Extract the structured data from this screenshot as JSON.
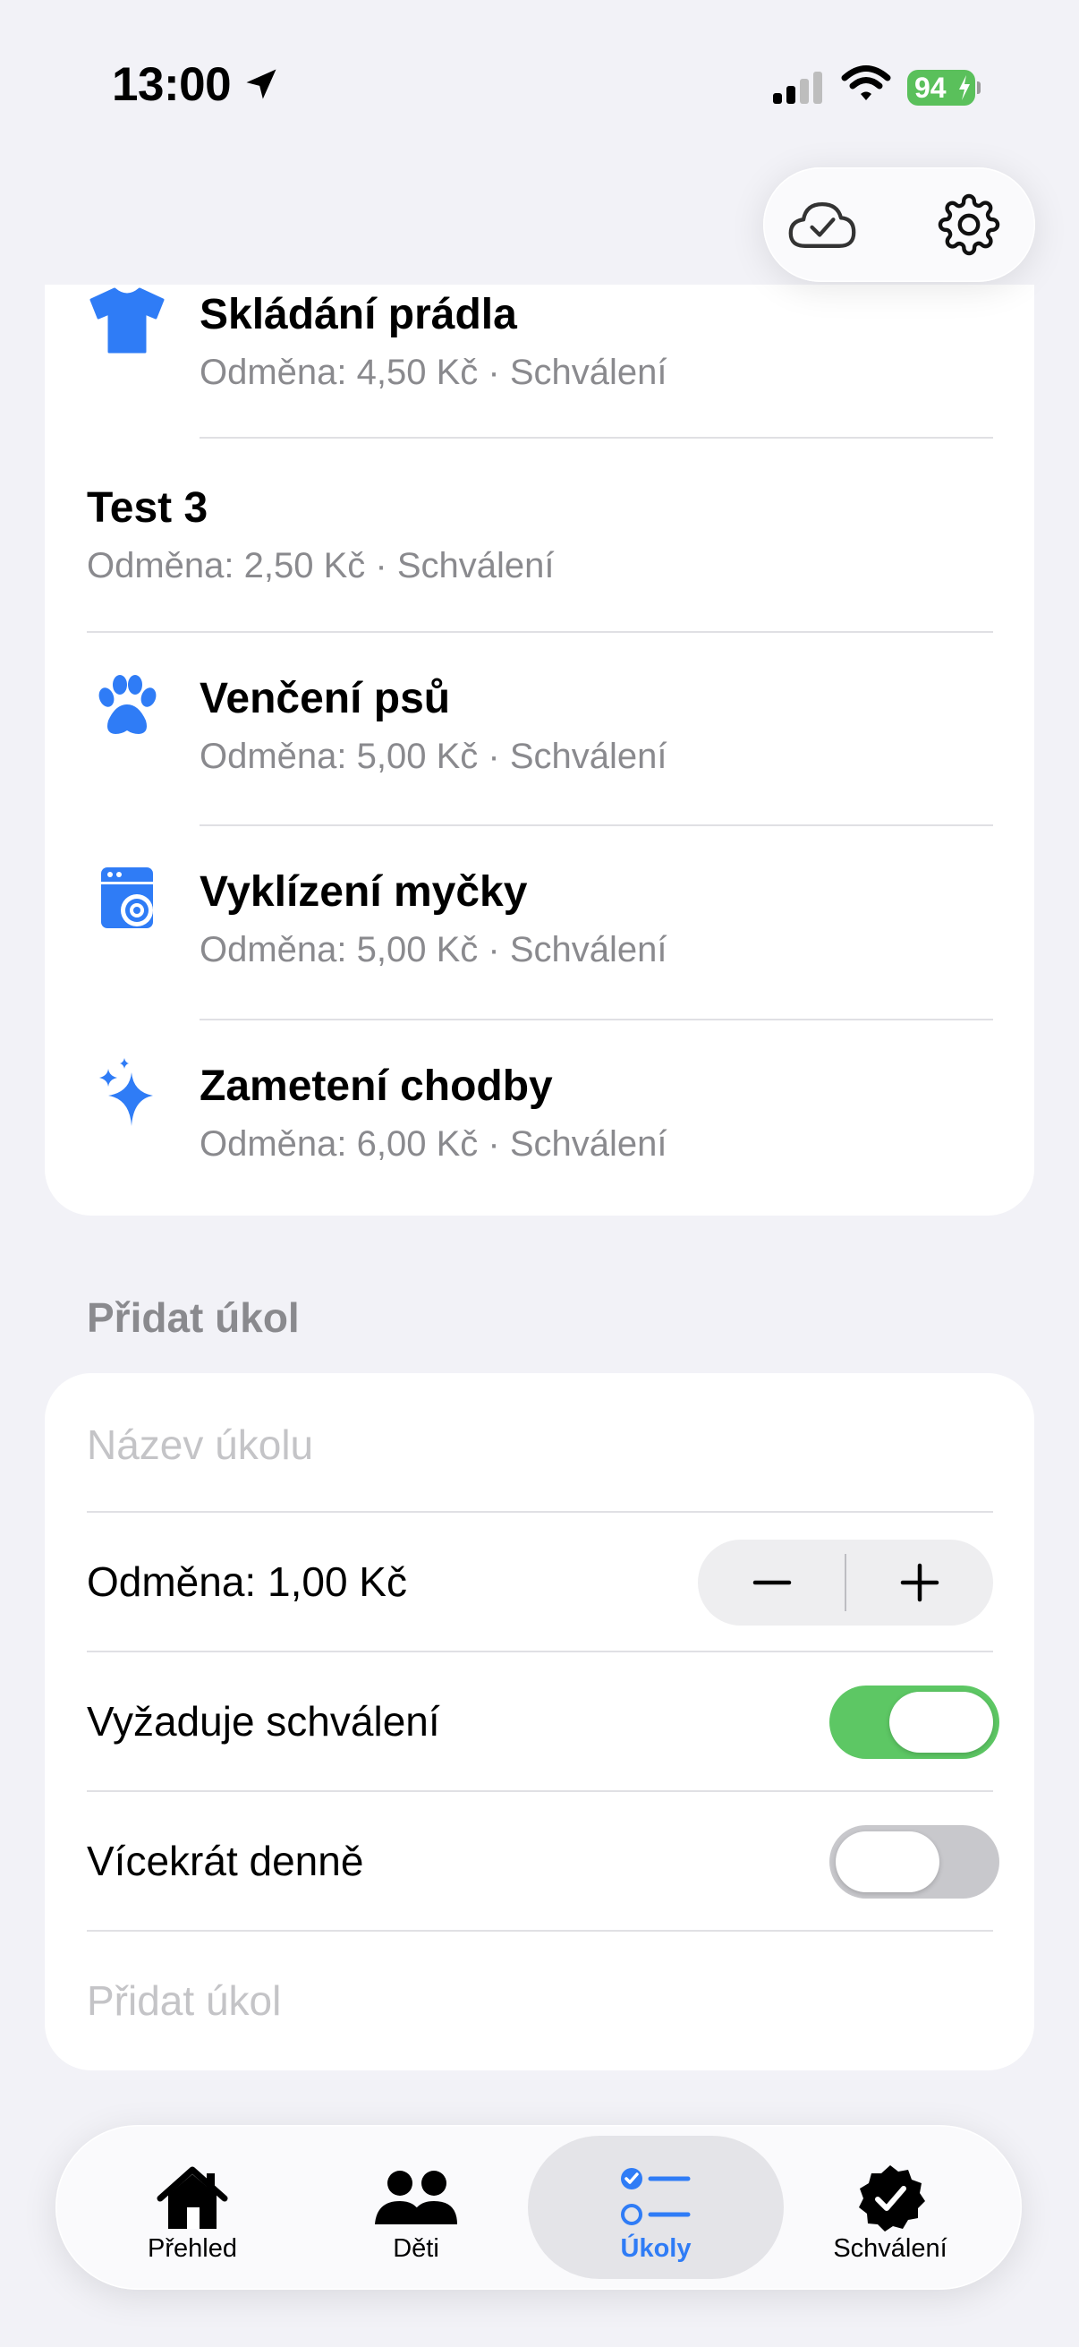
{
  "status_bar": {
    "time": "13:00",
    "battery": "94"
  },
  "colors": {
    "accent": "#2F7CF6",
    "toggle_on": "#5DC764",
    "secondary_text": "#8A8A8E"
  },
  "tasks": [
    {
      "title": "Skládání prádla",
      "subtitle": "Odměna: 4,50 Kč · Schválení",
      "icon": "tshirt-icon"
    },
    {
      "title": "Test 3",
      "subtitle": "Odměna: 2,50 Kč · Schválení",
      "icon": ""
    },
    {
      "title": "Venčení psů",
      "subtitle": "Odměna: 5,00 Kč · Schválení",
      "icon": "paw-icon"
    },
    {
      "title": "Vyklízení myčky",
      "subtitle": "Odměna: 5,00 Kč · Schválení",
      "icon": "dishwasher-icon"
    },
    {
      "title": "Zametení chodby",
      "subtitle": "Odměna: 6,00 Kč · Schválení",
      "icon": "sparkles-icon"
    }
  ],
  "add_task": {
    "section_title": "Přidat úkol",
    "name_placeholder": "Název úkolu",
    "reward_label": "Odměna: 1,00 Kč",
    "requires_approval_label": "Vyžaduje schválení",
    "requires_approval": true,
    "multiple_daily_label": "Vícekrát denně",
    "multiple_daily": false,
    "submit_label": "Přidat úkol"
  },
  "tabs": [
    {
      "label": "Přehled",
      "icon": "house-icon",
      "active": false
    },
    {
      "label": "Děti",
      "icon": "people-icon",
      "active": false
    },
    {
      "label": "Úkoly",
      "icon": "checklist-icon",
      "active": true
    },
    {
      "label": "Schválení",
      "icon": "checkmark-seal-icon",
      "active": false
    }
  ]
}
